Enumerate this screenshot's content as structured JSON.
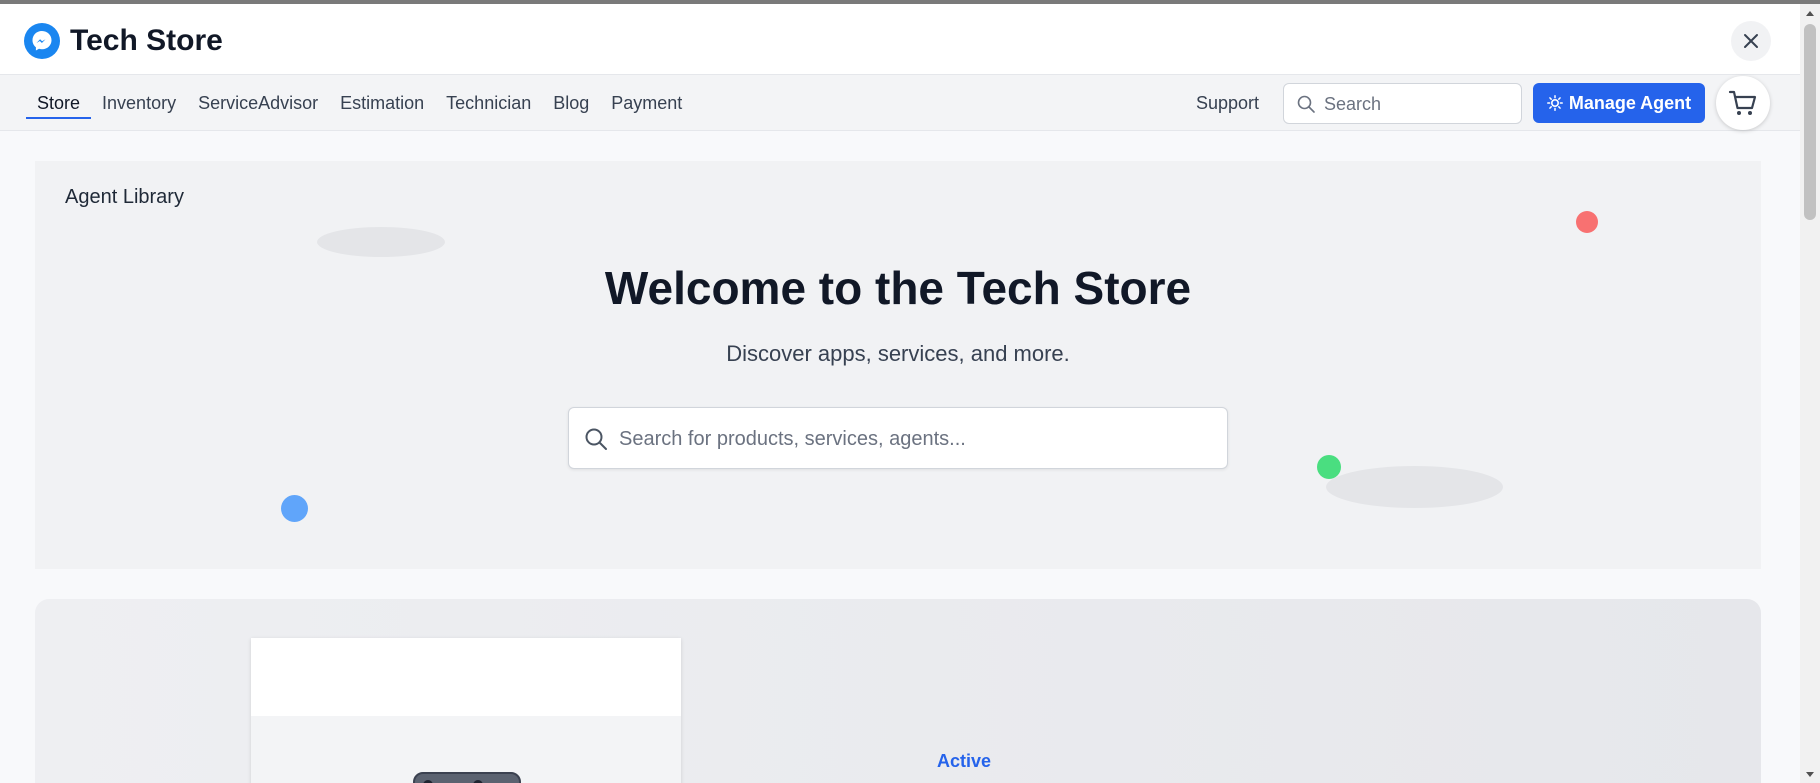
{
  "app": {
    "title": "Tech Store",
    "brand_color": "#1a86f0",
    "logo_icon": "messenger-icon",
    "close_icon": "close-icon"
  },
  "nav": {
    "tabs": [
      {
        "label": "Store",
        "active": true
      },
      {
        "label": "Inventory",
        "active": false
      },
      {
        "label": "ServiceAdvisor",
        "active": false
      },
      {
        "label": "Estimation",
        "active": false
      },
      {
        "label": "Technician",
        "active": false
      },
      {
        "label": "Blog",
        "active": false
      },
      {
        "label": "Payment",
        "active": false
      }
    ],
    "support_label": "Support",
    "search_placeholder": "Search",
    "search_value": "",
    "manage_agent_label": "Manage Agent",
    "manage_agent_icon": "sun-icon",
    "cart_icon": "cart-icon",
    "accent_color": "#2563eb"
  },
  "hero": {
    "section_label": "Agent Library",
    "title": "Welcome to the Tech Store",
    "subtitle": "Discover apps, services, and more.",
    "search_placeholder": "Search for products, services, agents...",
    "search_value": "",
    "dot_colors": [
      "#f87171",
      "#60a5fa",
      "#4ade80"
    ]
  },
  "featured": {
    "status": "Active",
    "status_color": "#2563eb",
    "image": "phone-image"
  }
}
